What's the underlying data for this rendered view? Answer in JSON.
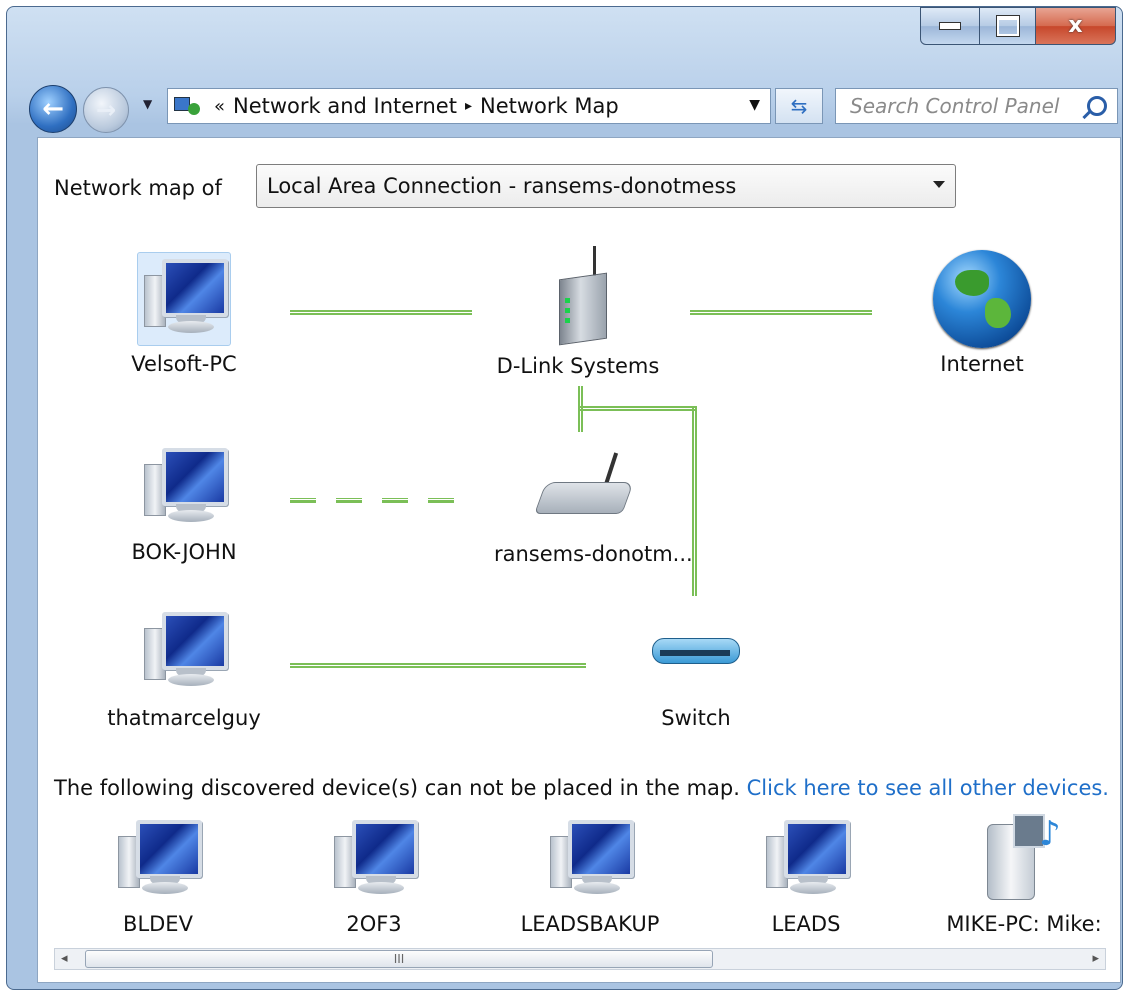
{
  "window": {
    "min_icon": "minimize-icon",
    "max_icon": "maximize-icon",
    "close_label": "x"
  },
  "nav": {
    "back_glyph": "←",
    "forward_glyph": "→",
    "breadcrumb_prefix": "«",
    "breadcrumb_sep": "▸",
    "breadcrumb": [
      "Network and Internet",
      "Network Map"
    ],
    "search_placeholder": "Search Control Panel"
  },
  "map_of": {
    "label": "Network map of",
    "selected": "Local Area Connection - ransems-donotmess"
  },
  "nodes": {
    "velsoft": "Velsoft-PC",
    "dlink": "D-Link Systems",
    "internet": "Internet",
    "bok": "BOK-JOHN",
    "ransems": "ransems-donotm...",
    "thatmarcel": "thatmarcelguy",
    "switch": "Switch"
  },
  "discovered": {
    "text": "The following discovered device(s) can not be placed in the map.",
    "link": "Click here to see all other devices.",
    "devices": [
      "BLDEV",
      "2OF3",
      "LEADSBAKUP",
      "LEADS",
      "MIKE-PC: Mike:"
    ]
  },
  "scrollbar": {
    "left_glyph": "◂",
    "right_glyph": "▸",
    "thumb_grip": "III"
  },
  "colors": {
    "link": "#1f6fc9",
    "connection_line": "#7bbf57",
    "chrome": "#aac4e2"
  }
}
